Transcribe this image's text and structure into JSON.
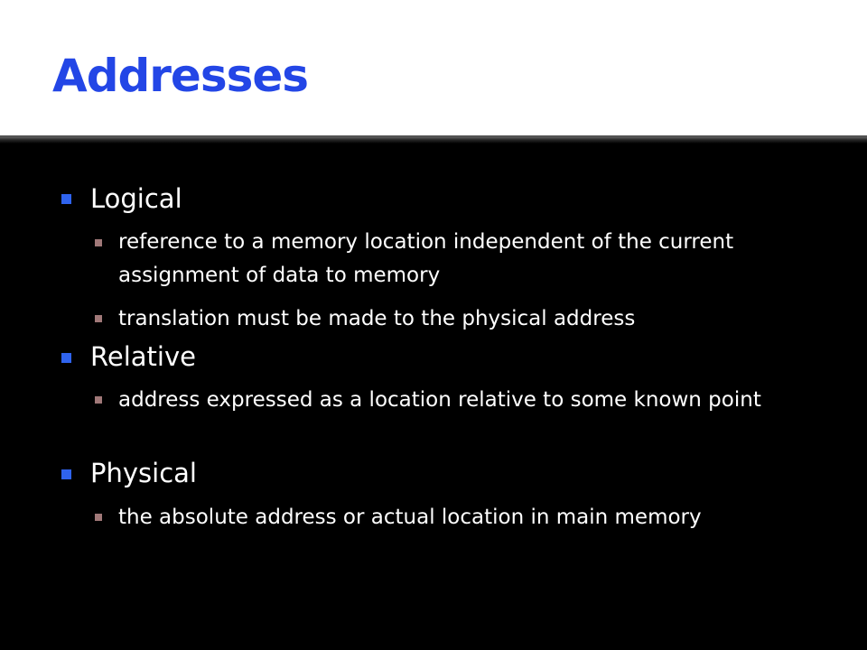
{
  "slide": {
    "title": "Addresses",
    "colors": {
      "title": "#2346e6",
      "background": "#000000",
      "title_band": "#ffffff",
      "level1_bullet": "#2f63ee",
      "level2_bullet": "#a07878",
      "body_text": "#ffffff"
    },
    "bullet_icons": {
      "level1": "square-bullet-icon",
      "level2": "small-square-bullet-icon"
    },
    "items": [
      {
        "label": "Logical",
        "subitems": [
          "reference to a memory location independent of the current assignment of data to memory",
          "translation must be made to the physical address"
        ]
      },
      {
        "label": "Relative",
        "subitems": [
          "address expressed as a location relative to some known point"
        ]
      },
      {
        "label": "Physical",
        "subitems": [
          "the absolute address or actual location in main memory"
        ]
      }
    ]
  }
}
